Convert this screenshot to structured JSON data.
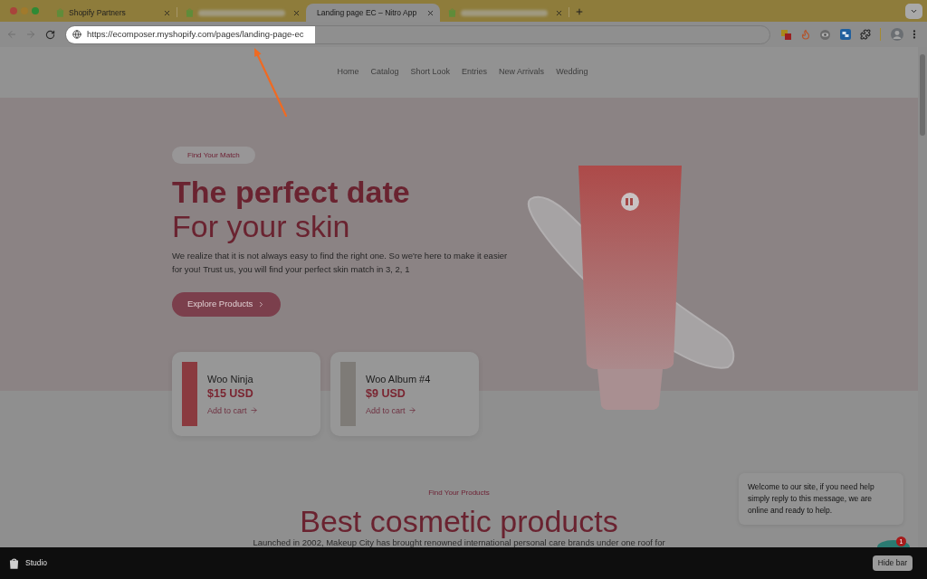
{
  "browser": {
    "tabs": [
      {
        "kind": "titled",
        "title": "Shopify Partners",
        "favicon": true,
        "selected": false
      },
      {
        "kind": "blurred",
        "favicon": true,
        "selected": false
      },
      {
        "kind": "titled",
        "title": "Landing page EC – Nitro App",
        "favicon": false,
        "selected": true
      },
      {
        "kind": "blurred",
        "favicon": true,
        "selected": false
      }
    ],
    "url": "https://ecomposer.myshopify.com/pages/landing-page-ec"
  },
  "nav": [
    "Home",
    "Catalog",
    "Short Look",
    "Entries",
    "New Arrivals",
    "Wedding"
  ],
  "hero": {
    "badge": "Find Your Match",
    "title": "The perfect date",
    "subtitle": "For your skin",
    "description": "We realize that it is not always easy to find the right one. So we're here to make it easier for you! Trust us, you will find your perfect skin match in 3, 2, 1",
    "button": "Explore Products"
  },
  "products": [
    {
      "name": "Woo Ninja",
      "price": "$15 USD",
      "action": "Add to cart"
    },
    {
      "name": "Woo Album #4",
      "price": "$9 USD",
      "action": "Add to cart"
    }
  ],
  "section": {
    "eyebrow": "Find Your Products",
    "title": "Best cosmetic products",
    "description": "Launched in 2002, Makeup City has brought renowned international personal care brands under one roof for"
  },
  "chat": {
    "message": "Welcome to our site, if you need help simply reply to this message, we are online and ready to help.",
    "unread": "1"
  },
  "studio_bar": {
    "label": "Studio",
    "button": "Hide bar"
  }
}
